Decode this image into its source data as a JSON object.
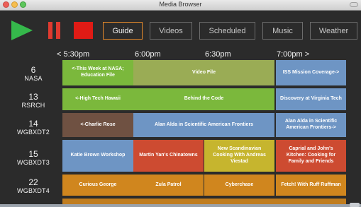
{
  "window": {
    "title": "Media Browser"
  },
  "toolbar": {
    "tabs": [
      {
        "label": "Guide",
        "active": true
      },
      {
        "label": "Videos",
        "active": false
      },
      {
        "label": "Scheduled",
        "active": false
      },
      {
        "label": "Music",
        "active": false
      },
      {
        "label": "Weather",
        "active": false
      }
    ]
  },
  "timeline": {
    "slots": [
      "< 5:30pm",
      "6:00pm",
      "6:30pm",
      "7:00pm >"
    ]
  },
  "channels": [
    {
      "number": "6",
      "name": "NASA"
    },
    {
      "number": "13",
      "name": "RSRCH"
    },
    {
      "number": "14",
      "name": "WGBXDT2"
    },
    {
      "number": "15",
      "name": "WGBXDT3"
    },
    {
      "number": "22",
      "name": "WGBXDT4"
    }
  ],
  "programs": {
    "r0": [
      "<-This Week at NASA; Education File",
      "Video File",
      "ISS Mission Coverage->"
    ],
    "r1": [
      "<-High Tech Hawaii",
      "Behind the Code",
      "Discovery at Virginia Tech"
    ],
    "r2": [
      "<-Charlie Rose",
      "Alan Alda in Scientific American Frontiers",
      "Alan Alda in Scientific American Frontiers->"
    ],
    "r3": [
      "Katie Brown Workshop",
      "Martin Yan's Chinatowns",
      "New Scandinavian Cooking With Andreas Viestad",
      "Caprial and John's Kitchen: Cooking for Family and Friends"
    ],
    "r4": [
      "Curious George",
      "Zula Patrol",
      "Cyberchase",
      "Fetch! With Ruff Ruffman"
    ]
  },
  "colors": {
    "green": "#7bb83c",
    "olive": "#9aac55",
    "blue": "#6e95c4",
    "brown": "#6f5142",
    "red": "#cd4b31",
    "yellow": "#c6b52e",
    "orange": "#d0861e",
    "accent": "#e4892b"
  }
}
